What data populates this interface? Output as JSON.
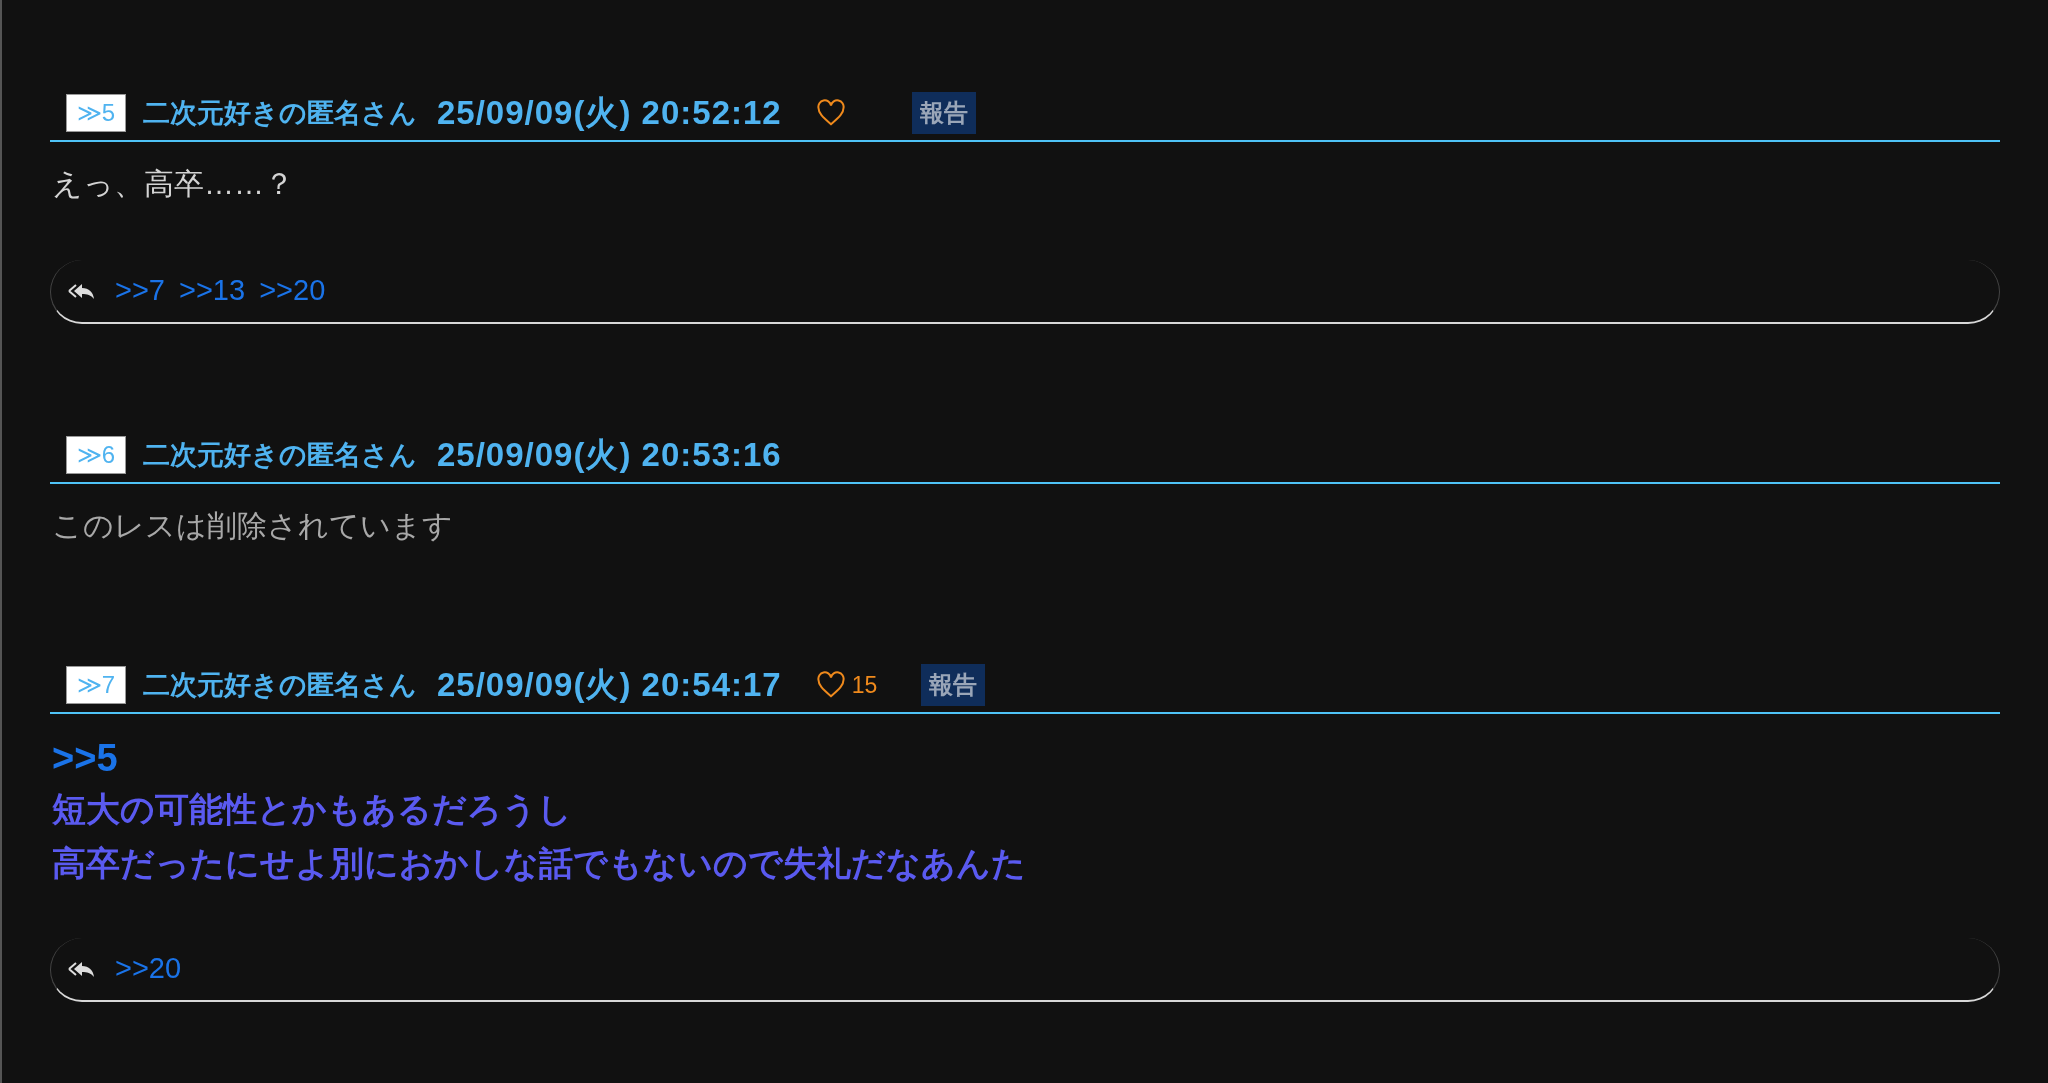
{
  "posts": [
    {
      "number": "≫5",
      "name": "二次元好きの匿名さん",
      "date": "25/09/09(火) 20:52:12",
      "like": true,
      "report": "報告",
      "kind": "plain",
      "body": [
        {
          "kind": "text",
          "text": "えっ、高卒……？"
        }
      ],
      "replies": [
        ">>7",
        ">>13",
        ">>20"
      ]
    },
    {
      "number": "≫6",
      "name": "二次元好きの匿名さん",
      "date": "25/09/09(火) 20:53:16",
      "like": false,
      "kind": "deleted",
      "body": [
        {
          "kind": "text",
          "text": "このレスは削除されています"
        }
      ]
    },
    {
      "number": "≫7",
      "name": "二次元好きの匿名さん",
      "date": "25/09/09(火) 20:54:17",
      "like": true,
      "like_count": "15",
      "report": "報告",
      "kind": "emphasis",
      "body": [
        {
          "kind": "anchor",
          "text": ">>5"
        },
        {
          "kind": "text",
          "text": "短大の可能性とかもあるだろうし"
        },
        {
          "kind": "text",
          "text": "高卒だったにせよ別におかしな話でもないので失礼だなあんた"
        }
      ],
      "replies": [
        ">>20"
      ]
    }
  ]
}
